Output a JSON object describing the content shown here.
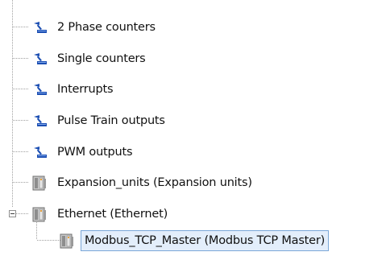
{
  "tree": {
    "nodes": [
      {
        "label": "2 Phase counters",
        "icon": "counter-function-icon"
      },
      {
        "label": "Single counters",
        "icon": "counter-function-icon"
      },
      {
        "label": "Interrupts",
        "icon": "counter-function-icon"
      },
      {
        "label": "Pulse Train outputs",
        "icon": "counter-function-icon"
      },
      {
        "label": "PWM outputs",
        "icon": "counter-function-icon"
      },
      {
        "label": "Expansion_units (Expansion units)",
        "icon": "device-module-icon"
      },
      {
        "label": "Ethernet (Ethernet)",
        "icon": "device-module-icon",
        "expanded": true
      },
      {
        "label": "Modbus_TCP_Master (Modbus TCP Master)",
        "icon": "device-module-icon",
        "selected": true
      }
    ]
  },
  "colors": {
    "selection_border": "#7aa7d8",
    "selection_fill": "#e3eefb",
    "tree_line": "#a0a0a0",
    "counter_icon_blue": "#1c4fb3",
    "module_icon_gray": "#9a9a9a"
  }
}
